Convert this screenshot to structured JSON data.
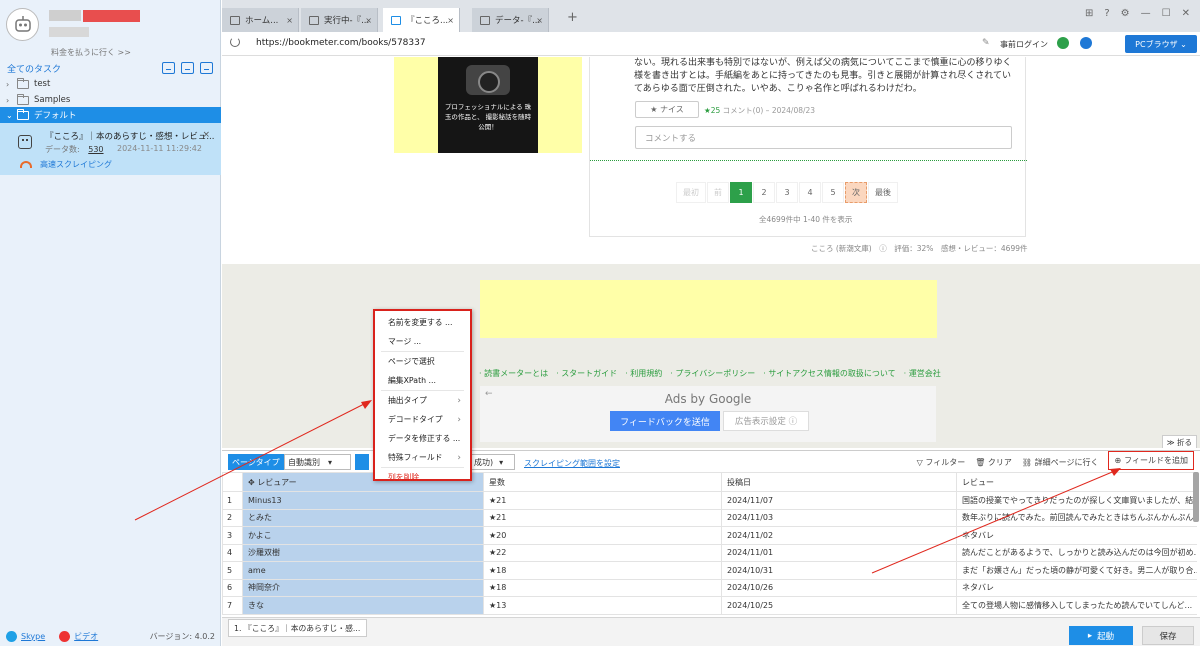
{
  "sidebar": {
    "pay_link": "料金を払うに行く >>",
    "tasks_title": "全てのタスク",
    "tree": [
      {
        "label": "test"
      },
      {
        "label": "Samples"
      },
      {
        "label": "デフォルト"
      }
    ],
    "task": {
      "title": "『こころ』｜本のあらすじ・感想・レビュ...",
      "data_label": "データ数",
      "data_count": "530",
      "date": "2024-11-11 11:29:42",
      "mode": "高速スクレイピング"
    },
    "footer": {
      "skype": "Skype",
      "video": "ビデオ",
      "version": "バージョン: 4.0.2"
    }
  },
  "tabs": [
    {
      "label": "ホーム..."
    },
    {
      "label": "実行中-『..."
    },
    {
      "label": "『こころ..."
    },
    {
      "label": "データ-『..."
    }
  ],
  "addressbar": {
    "url": "https://bookmeter.com/books/578337",
    "login": "事前ログイン",
    "pc_browser": "PCブラウザ"
  },
  "web": {
    "ad_text": "プロフェッショナルによる 珠玉の作品と、 撮影秘話を随時公開！",
    "review_text": "ない。現れる出来事も特別ではないが、例えば父の病気についてここまで慎重に心の移りゆく様を書き出すとは。手紙編をあとに持ってきたのも見事。引きと展開が計算され尽くされていてあらゆる面で圧倒された。いやあ、こりゃ名作と呼ばれるわけだわ。",
    "nice": "★ ナイス",
    "nice_count": "★25",
    "comment_meta": "コメント(0)",
    "review_date": "2024/08/23",
    "comment_placeholder": "コメントする",
    "pager": [
      "最初",
      "前",
      "1",
      "2",
      "3",
      "4",
      "5",
      "次",
      "最後"
    ],
    "pager_summary": "全4699件中 1-40 件を表示",
    "book_line": "こころ (新潮文庫)　ⓘ　評価：32%　感想・レビュー：4699件",
    "footer_links": [
      "読書メーターとは",
      "スタートガイド",
      "利用規約",
      "プライバシーポリシー",
      "サイトアクセス情報の取扱について",
      "運営会社"
    ],
    "google_ads_title": "Ads by Google",
    "google_feedback": "フィードバックを送信",
    "google_settings": "広告表示設定 ⓘ",
    "fold": "≫ 折る"
  },
  "context_menu": {
    "items": [
      "名前を変更する ...",
      "マージ ...",
      "ページで選択",
      "編集XPath ...",
      "抽出タイプ",
      "デコードタイプ",
      "データを修正する ...",
      "特殊フィールド",
      "列を削除"
    ]
  },
  "toolbar": {
    "page_type": "ページタイプ",
    "auto_detect": "自動識別",
    "success": "成功)",
    "scope_link": "スクレイピング範囲を設定",
    "filter": "フィルター",
    "clear": "クリア",
    "detail": "詳細ページに行く",
    "add_field": "フィールドを追加"
  },
  "table": {
    "headers": [
      "レビュアー",
      "星数",
      "投稿日",
      "レビュー"
    ],
    "rows": [
      [
        "1",
        "Minus13",
        "★21",
        "2024/11/07",
        "国語の授業でやってきりだったのが探しく文庫買いましたが、結..."
      ],
      [
        "2",
        "とみた",
        "★21",
        "2024/11/03",
        "数年ぶりに読んでみた。前回読んでみたときはちんぷんかんぷん..."
      ],
      [
        "3",
        "かよこ",
        "★20",
        "2024/11/02",
        "ネタバレ"
      ],
      [
        "4",
        "沙羅双樹",
        "★22",
        "2024/11/01",
        "読んだことがあるようで、しっかりと読み込んだのは今回が初め..."
      ],
      [
        "5",
        "ame",
        "★18",
        "2024/10/31",
        "まだ「お嬢さん」だった頃の静が可愛くて好き。男二人が取り合..."
      ],
      [
        "6",
        "神岡奈介",
        "★18",
        "2024/10/26",
        "ネタバレ"
      ],
      [
        "7",
        "きな",
        "★13",
        "2024/10/25",
        "全ての登場人物に感情移入してしまったため読んでいてしんど..."
      ]
    ]
  },
  "statusbar": {
    "task_tab": "1. 『こころ』｜本のあらすじ・感...",
    "start": "起動",
    "save": "保存"
  },
  "colors": {
    "accent": "#1e8ee6",
    "annotation": "#e0281e",
    "site_green": "#2da04a"
  }
}
